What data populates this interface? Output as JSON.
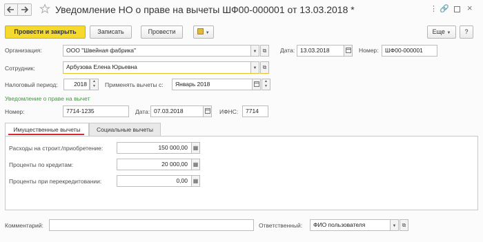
{
  "window": {
    "title": "Уведомление НО о праве на вычеты ШФ00-000001 от 13.03.2018 *",
    "back_icon": "arrow-left-icon",
    "forward_icon": "arrow-right-icon",
    "star_icon": "star-icon"
  },
  "toolbar": {
    "post_close_label": "Провести и закрыть",
    "write_label": "Записать",
    "post_label": "Провести",
    "more_label": "Еще",
    "help_label": "?"
  },
  "form": {
    "org_label": "Организация:",
    "org_value": "ООО \"Швейная фабрика\"",
    "date_label": "Дата:",
    "date_value": "13.03.2018",
    "number_label": "Номер:",
    "number_value": "ШФ00-000001",
    "employee_label": "Сотрудник:",
    "employee_value": "Арбузова Елена Юрьевна",
    "tax_period_label": "Налоговый период:",
    "tax_period_value": "2018",
    "apply_from_label": "Применять вычеты с:",
    "apply_from_value": "Январь 2018",
    "notice_section_title": "Уведомление о праве на вычет",
    "notice_number_label": "Номер:",
    "notice_number_value": "7714-1235",
    "notice_date_label": "Дата:",
    "notice_date_value": "07.03.2018",
    "ifns_label": "ИФНС:",
    "ifns_value": "7714"
  },
  "tabs": [
    {
      "label": "Имущественные вычеты",
      "active": true
    },
    {
      "label": "Социальные вычеты",
      "active": false
    }
  ],
  "property": {
    "construction_label": "Расходы на строит./приобретение:",
    "construction_value": "150 000,00",
    "interest_label": "Проценты по кредитам:",
    "interest_value": "20 000,00",
    "refinance_label": "Проценты при перекредитовании:",
    "refinance_value": "0,00"
  },
  "footer": {
    "comment_label": "Комментарий:",
    "comment_value": "",
    "responsible_label": "Ответственный:",
    "responsible_value": "ФИО пользователя"
  },
  "colors": {
    "primary_button": "#f5da2d",
    "section_green": "#3a9a3a",
    "tab_underline": "#d9232d",
    "focus_border": "#e6c12a"
  }
}
